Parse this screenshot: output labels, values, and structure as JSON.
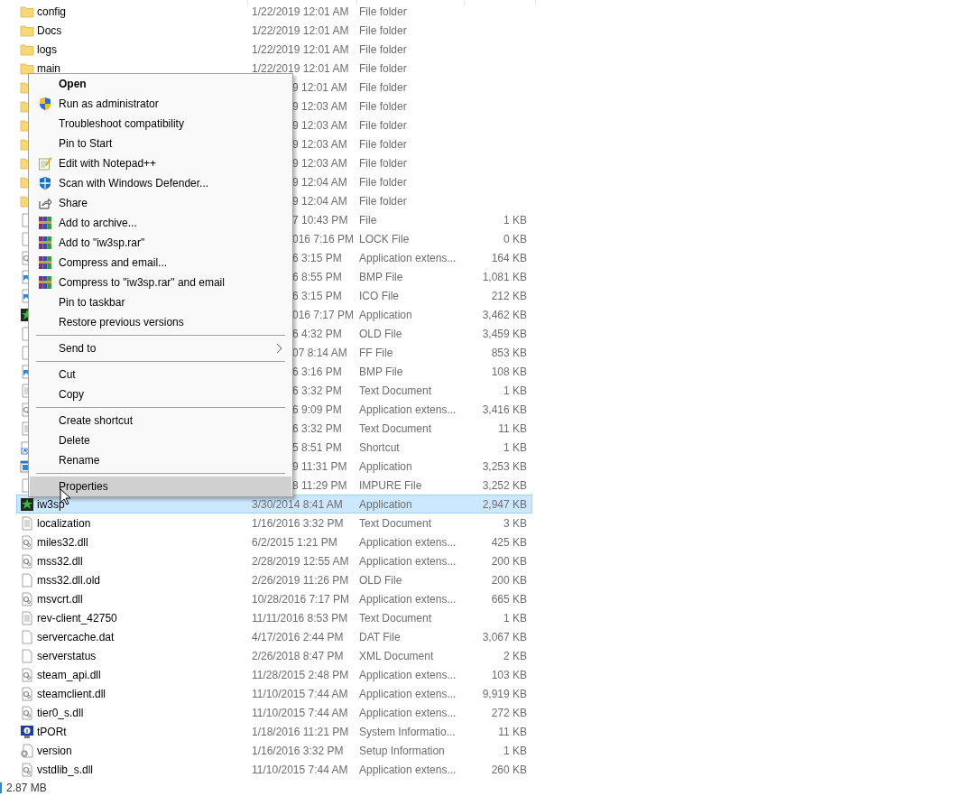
{
  "files": [
    {
      "kind": "folder",
      "name": "config",
      "date": "1/22/2019 12:01 AM",
      "type": "File folder",
      "selected": false
    },
    {
      "kind": "folder",
      "name": "Docs",
      "date": "1/22/2019 12:01 AM",
      "type": "File folder",
      "selected": false
    },
    {
      "kind": "folder",
      "name": "logs",
      "date": "1/22/2019 12:01 AM",
      "type": "File folder",
      "selected": false
    },
    {
      "kind": "folder",
      "name": "main",
      "date": "1/22/2019 12:01 AM",
      "type": "File folder",
      "selected": false
    },
    {
      "kind": "folder",
      "date": "9 12:01 AM",
      "type": "File folder",
      "selected": false
    },
    {
      "kind": "folder",
      "date": "9 12:03 AM",
      "type": "File folder",
      "selected": false
    },
    {
      "kind": "folder",
      "date": "9 12:03 AM",
      "type": "File folder",
      "selected": false
    },
    {
      "kind": "folder",
      "date": "9 12:03 AM",
      "type": "File folder",
      "selected": false
    },
    {
      "kind": "folder",
      "date": "9 12:03 AM",
      "type": "File folder",
      "selected": false
    },
    {
      "kind": "folder",
      "date": "9 12:04 AM",
      "type": "File folder",
      "selected": false
    },
    {
      "kind": "folder",
      "date": "9 12:04 AM",
      "type": "File folder",
      "selected": false
    },
    {
      "kind": "file",
      "date": "7 10:43 PM",
      "type": "File",
      "size": "1 KB",
      "selected": false
    },
    {
      "kind": "file",
      "date": "016 7:16 PM",
      "type": "LOCK File",
      "size": "0 KB",
      "selected": false
    },
    {
      "kind": "dll",
      "date": "6 3:15 PM",
      "type": "Application extens...",
      "size": "164 KB",
      "selected": false
    },
    {
      "kind": "image",
      "date": "6 8:55 PM",
      "type": "BMP File",
      "size": "1,081 KB",
      "selected": false
    },
    {
      "kind": "image",
      "date": "6 3:15 PM",
      "type": "ICO File",
      "size": "212 KB",
      "selected": false
    },
    {
      "kind": "app",
      "date": "016 7:17 PM",
      "type": "Application",
      "size": "3,462 KB",
      "selected": false
    },
    {
      "kind": "file",
      "date": "6 4:32 PM",
      "type": "OLD File",
      "size": "3,459 KB",
      "selected": false
    },
    {
      "kind": "file",
      "date": "07 8:14 AM",
      "type": "FF File",
      "size": "853 KB",
      "selected": false
    },
    {
      "kind": "image",
      "date": "6 3:16 PM",
      "type": "BMP File",
      "size": "108 KB",
      "selected": false
    },
    {
      "kind": "text",
      "date": "6 3:32 PM",
      "type": "Text Document",
      "size": "1 KB",
      "selected": false
    },
    {
      "kind": "dll",
      "date": "6 9:09 PM",
      "type": "Application extens...",
      "size": "3,416 KB",
      "selected": false
    },
    {
      "kind": "text",
      "date": "6 3:32 PM",
      "type": "Text Document",
      "size": "11 KB",
      "selected": false
    },
    {
      "kind": "shortcut",
      "date": "5 8:51 PM",
      "type": "Shortcut",
      "size": "1 KB",
      "selected": false
    },
    {
      "kind": "window",
      "date": "9 11:31 PM",
      "type": "Application",
      "size": "3,253 KB",
      "selected": false
    },
    {
      "kind": "file",
      "date": "8 11:29 PM",
      "type": "IMPURE File",
      "size": "3,252 KB",
      "selected": false
    },
    {
      "kind": "app",
      "name": "iw3sp",
      "date": "3/30/2014 8:41 AM",
      "type": "Application",
      "size": "2,947 KB",
      "selected": true
    },
    {
      "kind": "text",
      "name": "localization",
      "date": "1/16/2016 3:32 PM",
      "type": "Text Document",
      "size": "3 KB",
      "selected": false
    },
    {
      "kind": "dll",
      "name": "miles32.dll",
      "date": "6/2/2015 1:21 PM",
      "type": "Application extens...",
      "size": "425 KB",
      "selected": false
    },
    {
      "kind": "dll",
      "name": "mss32.dll",
      "date": "2/28/2019 12:55 AM",
      "type": "Application extens...",
      "size": "200 KB",
      "selected": false
    },
    {
      "kind": "file",
      "name": "mss32.dll.old",
      "date": "2/26/2019 11:26 PM",
      "type": "OLD File",
      "size": "200 KB",
      "selected": false
    },
    {
      "kind": "dll",
      "name": "msvcrt.dll",
      "date": "10/28/2016 7:17 PM",
      "type": "Application extens...",
      "size": "665 KB",
      "selected": false
    },
    {
      "kind": "text",
      "name": "rev-client_42750",
      "date": "11/11/2016 8:53 PM",
      "type": "Text Document",
      "size": "1 KB",
      "selected": false
    },
    {
      "kind": "file",
      "name": "servercache.dat",
      "date": "4/17/2016 2:44 PM",
      "type": "DAT File",
      "size": "3,067 KB",
      "selected": false
    },
    {
      "kind": "file",
      "name": "serverstatus",
      "date": "2/26/2018 8:47 PM",
      "type": "XML Document",
      "size": "2 KB",
      "selected": false
    },
    {
      "kind": "dll",
      "name": "steam_api.dll",
      "date": "11/28/2015 2:48 PM",
      "type": "Application extens...",
      "size": "103 KB",
      "selected": false
    },
    {
      "kind": "dll",
      "name": "steamclient.dll",
      "date": "11/10/2015 7:44 AM",
      "type": "Application extens...",
      "size": "9,919 KB",
      "selected": false
    },
    {
      "kind": "dll",
      "name": "tier0_s.dll",
      "date": "11/10/2015 7:44 AM",
      "type": "Application extens...",
      "size": "272 KB",
      "selected": false
    },
    {
      "kind": "sysinfo",
      "name": "tPORt",
      "date": "1/18/2016 11:21 PM",
      "type": "System Informatio...",
      "size": "11 KB",
      "selected": false
    },
    {
      "kind": "setup",
      "name": "version",
      "date": "1/16/2016 3:32 PM",
      "type": "Setup Information",
      "size": "1 KB",
      "selected": false
    },
    {
      "kind": "dll",
      "name": "vstdlib_s.dll",
      "date": "11/10/2015 7:44 AM",
      "type": "Application extens...",
      "size": "260 KB",
      "selected": false
    }
  ],
  "context_menu": [
    {
      "kind": "plain",
      "label": "Open",
      "default": true,
      "selected": false
    },
    {
      "kind": "shield",
      "label": "Run as administrator",
      "default": false,
      "selected": false
    },
    {
      "kind": "plain",
      "label": "Troubleshoot compatibility",
      "default": false,
      "selected": false
    },
    {
      "kind": "plain",
      "label": "Pin to Start",
      "default": false,
      "selected": false
    },
    {
      "kind": "notepad",
      "label": "Edit with Notepad++",
      "default": false,
      "selected": false
    },
    {
      "kind": "defender",
      "label": "Scan with Windows Defender...",
      "default": false,
      "selected": false
    },
    {
      "kind": "share",
      "label": "Share",
      "default": false,
      "selected": false
    },
    {
      "kind": "archive",
      "label": "Add to archive...",
      "default": false,
      "selected": false
    },
    {
      "kind": "archive",
      "label": "Add to \"iw3sp.rar\"",
      "default": false,
      "selected": false
    },
    {
      "kind": "archive",
      "label": "Compress and email...",
      "default": false,
      "selected": false
    },
    {
      "kind": "archive",
      "label": "Compress to \"iw3sp.rar\" and email",
      "default": false,
      "selected": false
    },
    {
      "kind": "plain",
      "label": "Pin to taskbar",
      "default": false,
      "selected": false
    },
    {
      "kind": "plain",
      "label": "Restore previous versions",
      "default": false,
      "selected": false
    },
    {
      "kind": "separator"
    },
    {
      "kind": "submenu",
      "label": "Send to",
      "default": false,
      "selected": false
    },
    {
      "kind": "separator"
    },
    {
      "kind": "plain",
      "label": "Cut",
      "default": false,
      "selected": false
    },
    {
      "kind": "plain",
      "label": "Copy",
      "default": false,
      "selected": false
    },
    {
      "kind": "separator"
    },
    {
      "kind": "plain",
      "label": "Create shortcut",
      "default": false,
      "selected": false
    },
    {
      "kind": "plain",
      "label": "Delete",
      "default": false,
      "selected": false
    },
    {
      "kind": "plain",
      "label": "Rename",
      "default": false,
      "selected": false
    },
    {
      "kind": "separator"
    },
    {
      "kind": "plain",
      "label": "Properties",
      "default": false,
      "selected": true
    }
  ],
  "status_bar": {
    "size": "2.87 MB"
  }
}
